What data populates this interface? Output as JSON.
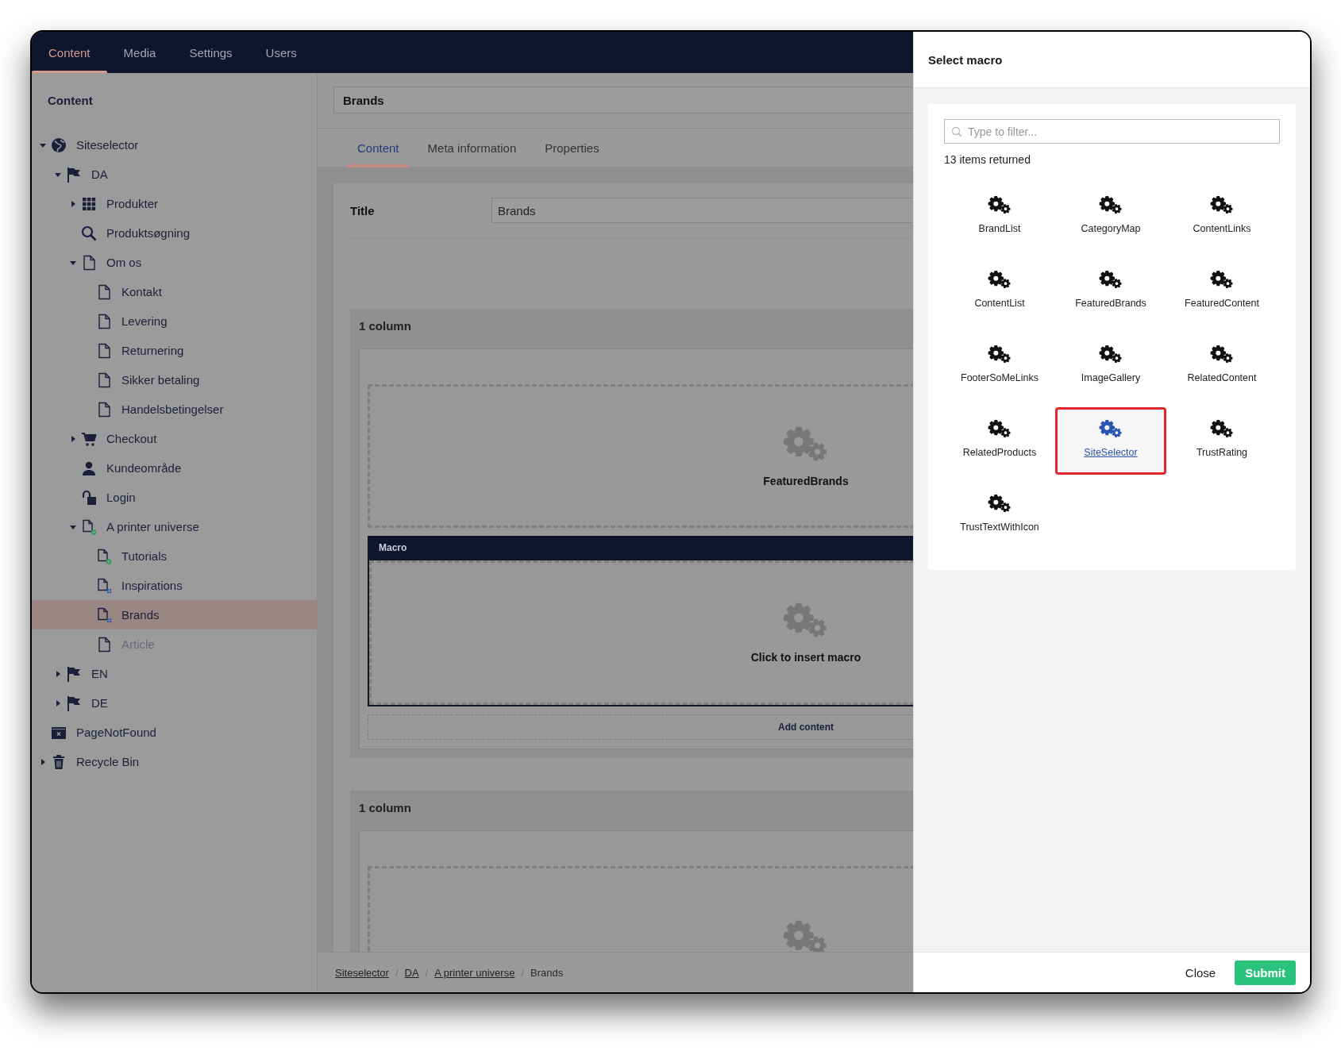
{
  "top_nav": {
    "sections": [
      {
        "label": "Content",
        "selected": true
      },
      {
        "label": "Media",
        "selected": false
      },
      {
        "label": "Settings",
        "selected": false
      },
      {
        "label": "Users",
        "selected": false
      }
    ]
  },
  "sidebar": {
    "title": "Content",
    "tree": [
      {
        "label": "Siteselector",
        "kind": "globe",
        "expanded": true,
        "selected": false,
        "disabled": false,
        "children": [
          {
            "label": "DA",
            "kind": "flag",
            "expanded": true,
            "selected": false,
            "disabled": false,
            "children": [
              {
                "label": "Produkter",
                "kind": "grid",
                "expanded": false,
                "selected": false,
                "disabled": false
              },
              {
                "label": "Produktsøgning",
                "kind": "search",
                "selected": false,
                "disabled": false
              },
              {
                "label": "Om os",
                "kind": "document",
                "expanded": true,
                "selected": false,
                "disabled": false,
                "children": [
                  {
                    "label": "Kontakt",
                    "kind": "document",
                    "selected": false,
                    "disabled": false
                  },
                  {
                    "label": "Levering",
                    "kind": "document",
                    "selected": false,
                    "disabled": false
                  },
                  {
                    "label": "Returnering",
                    "kind": "document",
                    "selected": false,
                    "disabled": false
                  },
                  {
                    "label": "Sikker betaling",
                    "kind": "document",
                    "selected": false,
                    "disabled": false
                  },
                  {
                    "label": "Handelsbetingelser",
                    "kind": "document",
                    "selected": false,
                    "disabled": false
                  }
                ]
              },
              {
                "label": "Checkout",
                "kind": "cart",
                "expanded": false,
                "selected": false,
                "disabled": false
              },
              {
                "label": "Kundeområde",
                "kind": "user",
                "selected": false,
                "disabled": false
              },
              {
                "label": "Login",
                "kind": "unlock",
                "selected": false,
                "disabled": false
              },
              {
                "label": "A printer universe",
                "kind": "document-plus",
                "expanded": true,
                "selected": false,
                "disabled": false,
                "children": [
                  {
                    "label": "Tutorials",
                    "kind": "document-plus",
                    "selected": false,
                    "disabled": false
                  },
                  {
                    "label": "Inspirations",
                    "kind": "document-grid",
                    "selected": false,
                    "disabled": false
                  },
                  {
                    "label": "Brands",
                    "kind": "document-grid",
                    "selected": true,
                    "disabled": false
                  },
                  {
                    "label": "Article",
                    "kind": "document",
                    "selected": false,
                    "disabled": true
                  }
                ]
              }
            ]
          },
          {
            "label": "EN",
            "kind": "flag",
            "expanded": false,
            "selected": false,
            "disabled": false
          },
          {
            "label": "DE",
            "kind": "flag",
            "expanded": false,
            "selected": false,
            "disabled": false
          }
        ]
      },
      {
        "label": "PageNotFound",
        "kind": "window-x",
        "selected": false,
        "disabled": false
      },
      {
        "label": "Recycle Bin",
        "kind": "trash",
        "expanded": false,
        "selected": false,
        "disabled": false
      }
    ]
  },
  "editor": {
    "name": "Brands",
    "tabs": [
      {
        "label": "Content",
        "selected": true
      },
      {
        "label": "Meta information",
        "selected": false
      },
      {
        "label": "Properties",
        "selected": false
      }
    ],
    "title_label": "Title",
    "title_value": "Brands",
    "sections": [
      {
        "heading": "1 column",
        "cells": [
          {
            "kind": "macro",
            "label": "FeaturedBrands"
          },
          {
            "kind": "macro-control",
            "header": "Macro",
            "label": "Click to insert macro"
          }
        ],
        "add_label": "Add content"
      },
      {
        "heading": "1 column",
        "cells": [
          {
            "kind": "macro"
          }
        ]
      }
    ],
    "breadcrumb": {
      "links": [
        "Siteselector",
        "DA",
        "A printer universe"
      ],
      "current": "Brands",
      "separator": "/"
    }
  },
  "dialog": {
    "title": "Select macro",
    "filter_placeholder": "Type to filter...",
    "count": "13 items returned",
    "macros": [
      {
        "name": "BrandList",
        "selected": false
      },
      {
        "name": "CategoryMap",
        "selected": false
      },
      {
        "name": "ContentLinks",
        "selected": false
      },
      {
        "name": "ContentList",
        "selected": false
      },
      {
        "name": "FeaturedBrands",
        "selected": false
      },
      {
        "name": "FeaturedContent",
        "selected": false
      },
      {
        "name": "FooterSoMeLinks",
        "selected": false
      },
      {
        "name": "ImageGallery",
        "selected": false
      },
      {
        "name": "RelatedContent",
        "selected": false
      },
      {
        "name": "RelatedProducts",
        "selected": false
      },
      {
        "name": "SiteSelector",
        "selected": true
      },
      {
        "name": "TrustRating",
        "selected": false
      },
      {
        "name": "TrustTextWithIcon",
        "selected": false
      }
    ],
    "buttons": [
      {
        "label": "Close",
        "kind": "link"
      },
      {
        "label": "Submit",
        "kind": "primary"
      }
    ]
  }
}
